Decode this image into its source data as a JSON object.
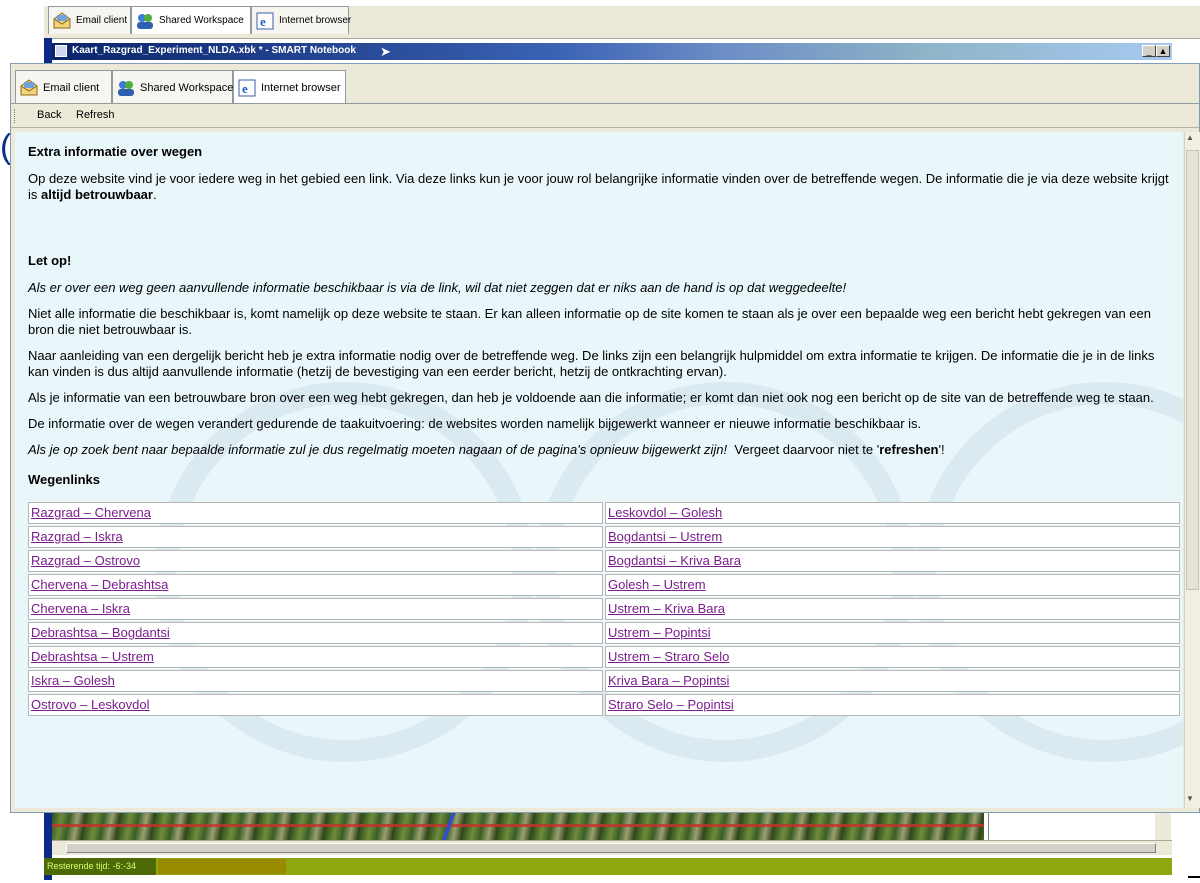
{
  "colors": {
    "link_visited": "#7a1e8c",
    "content_bg": "#e9f7fb",
    "title_bar": "#0a246a",
    "status_bar": "#8fa70f"
  },
  "background_window": {
    "tabs": [
      {
        "label": "Email client",
        "icon": "email-client-icon"
      },
      {
        "label": "Shared Workspace",
        "icon": "shared-workspace-icon"
      },
      {
        "label": "Internet browser",
        "icon": "internet-browser-icon"
      }
    ],
    "title": "Kaart_Razgrad_Experiment_NLDA.xbk * - SMART Notebook",
    "status_timer": "Resterende tijd: -6:-34"
  },
  "browser": {
    "tabs": [
      {
        "label": "Email client",
        "icon": "email-client-icon"
      },
      {
        "label": "Shared Workspace",
        "icon": "shared-workspace-icon"
      },
      {
        "label": "Internet browser",
        "icon": "internet-browser-icon"
      }
    ],
    "toolbar": {
      "back": "Back",
      "refresh": "Refresh"
    },
    "content": {
      "heading": "Extra informatie over wegen",
      "intro_pre": "Op deze website vind je voor iedere weg in het gebied een link. Via deze links kun je voor jouw rol belangrijke informatie vinden over de betreffende wegen. De informatie die je via deze website krijgt is ",
      "intro_bold": "altijd betrouwbaar",
      "intro_post": ".",
      "let_op_heading": "Let op!",
      "warning_italic": "Als er over een weg geen aanvullende informatie beschikbaar is via de link, wil dat niet zeggen dat er niks aan de hand is op dat weggedeelte!",
      "p1": "Niet alle informatie die beschikbaar is, komt namelijk op deze website te staan. Er kan alleen informatie op de site komen te staan als je over een bepaalde weg een bericht hebt gekregen van een bron die niet betrouwbaar is.",
      "p2": "Naar aanleiding van een dergelijk bericht heb je extra informatie nodig over de betreffende weg. De links zijn een belangrijk hulpmiddel om extra informatie te krijgen. De informatie die je in de links kan vinden is dus altijd aanvullende informatie (hetzij de bevestiging van een eerder bericht, hetzij de ontkrachting ervan).",
      "p3": "Als je informatie van een betrouwbare bron over een weg hebt gekregen, dan heb je voldoende aan die informatie; er komt dan niet ook nog een bericht op de site van de betreffende weg te staan.",
      "p4": "De informatie over de wegen verandert gedurende de taakuitvoering: de websites worden namelijk bijgewerkt wanneer er nieuwe informatie beschikbaar is.",
      "p5_italic": "Als je op zoek bent naar bepaalde informatie zul je dus regelmatig moeten nagaan of de pagina's opnieuw bijgewerkt zijn!",
      "p5_pre": "  Vergeet daarvoor niet te '",
      "p5_bold": "refreshen",
      "p5_post": "'!",
      "links_heading": "Wegenlinks",
      "links": [
        [
          "Razgrad – Chervena",
          "Leskovdol – Golesh"
        ],
        [
          "Razgrad – Iskra",
          "Bogdantsi – Ustrem"
        ],
        [
          "Razgrad – Ostrovo",
          "Bogdantsi – Kriva Bara"
        ],
        [
          "Chervena – Debrashtsa",
          "Golesh – Ustrem"
        ],
        [
          "Chervena – Iskra",
          "Ustrem – Kriva Bara"
        ],
        [
          "Debrashtsa – Bogdantsi",
          "Ustrem – Popintsi"
        ],
        [
          "Debrashtsa – Ustrem",
          "Ustrem – Straro Selo"
        ],
        [
          "Iskra – Golesh",
          "Kriva Bara – Popintsi"
        ],
        [
          "Ostrovo – Leskovdol",
          "Straro Selo – Popintsi"
        ]
      ]
    }
  }
}
